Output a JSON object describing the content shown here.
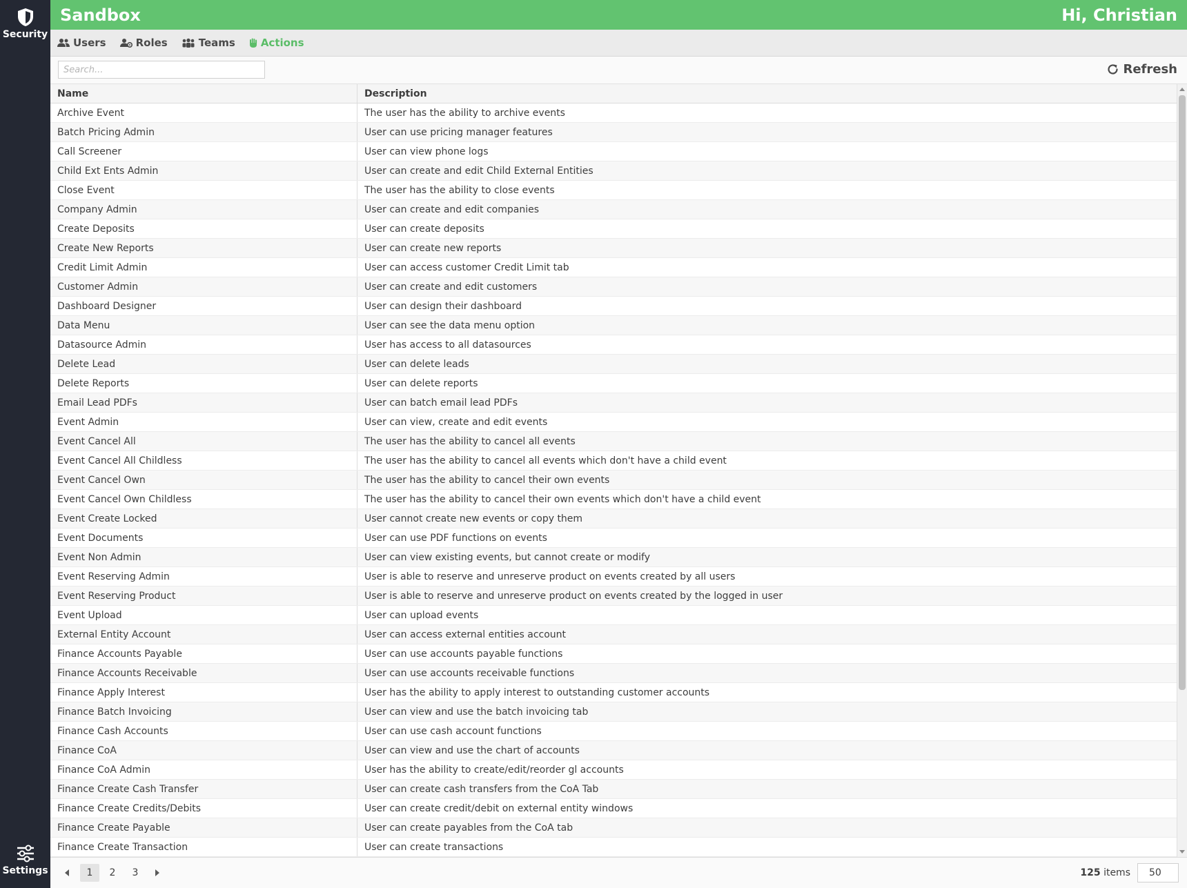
{
  "rail": {
    "top_label": "Security",
    "bottom_label": "Settings"
  },
  "header": {
    "title": "Sandbox",
    "greeting": "Hi, Christian"
  },
  "tabs": [
    {
      "label": "Users",
      "icon": "users-icon"
    },
    {
      "label": "Roles",
      "icon": "user-role-icon"
    },
    {
      "label": "Teams",
      "icon": "teams-icon"
    },
    {
      "label": "Actions",
      "icon": "hand-icon",
      "active": true
    }
  ],
  "toolbar": {
    "search_placeholder": "Search...",
    "refresh_label": "Refresh"
  },
  "grid": {
    "columns": [
      "Name",
      "Description"
    ],
    "rows": [
      [
        "Archive Event",
        "The user has the ability to archive events"
      ],
      [
        "Batch Pricing Admin",
        "User can use pricing manager features"
      ],
      [
        "Call Screener",
        "User can view phone logs"
      ],
      [
        "Child Ext Ents Admin",
        "User can create and edit Child External Entities"
      ],
      [
        "Close Event",
        "The user has the ability to close events"
      ],
      [
        "Company Admin",
        "User can create and edit companies"
      ],
      [
        "Create Deposits",
        "User can create deposits"
      ],
      [
        "Create New Reports",
        "User can create new reports"
      ],
      [
        "Credit Limit Admin",
        "User can access customer Credit Limit tab"
      ],
      [
        "Customer Admin",
        "User can create and edit customers"
      ],
      [
        "Dashboard Designer",
        "User can design their dashboard"
      ],
      [
        "Data Menu",
        "User can see the data menu option"
      ],
      [
        "Datasource Admin",
        "User has access to all datasources"
      ],
      [
        "Delete Lead",
        "User can delete leads"
      ],
      [
        "Delete Reports",
        "User can delete reports"
      ],
      [
        "Email Lead PDFs",
        "User can batch email lead PDFs"
      ],
      [
        "Event Admin",
        "User can view, create and edit events"
      ],
      [
        "Event Cancel All",
        "The user has the ability to cancel all events"
      ],
      [
        "Event Cancel All Childless",
        "The user has the ability to cancel all events which don't have a child event"
      ],
      [
        "Event Cancel Own",
        "The user has the ability to cancel their own events"
      ],
      [
        "Event Cancel Own Childless",
        "The user has the ability to cancel their own events which don't have a child event"
      ],
      [
        "Event Create Locked",
        "User cannot create new events or copy them"
      ],
      [
        "Event Documents",
        "User can use PDF functions on events"
      ],
      [
        "Event Non Admin",
        "User can view existing events, but cannot create or modify"
      ],
      [
        "Event Reserving Admin",
        "User is able to reserve and unreserve product on events created by all users"
      ],
      [
        "Event Reserving Product",
        "User is able to reserve and unreserve product on events created by the logged in user"
      ],
      [
        "Event Upload",
        "User can upload events"
      ],
      [
        "External Entity Account",
        "User can access external entities account"
      ],
      [
        "Finance Accounts Payable",
        "User can use accounts payable functions"
      ],
      [
        "Finance Accounts Receivable",
        "User can use accounts receivable functions"
      ],
      [
        "Finance Apply Interest",
        "User has the ability to apply interest to outstanding customer accounts"
      ],
      [
        "Finance Batch Invoicing",
        "User can view and use the batch invoicing tab"
      ],
      [
        "Finance Cash Accounts",
        "User can use cash account functions"
      ],
      [
        "Finance CoA",
        "User can view and use the chart of accounts"
      ],
      [
        "Finance CoA Admin",
        "User has the ability to create/edit/reorder gl accounts"
      ],
      [
        "Finance Create Cash Transfer",
        "User can create cash transfers from the CoA Tab"
      ],
      [
        "Finance Create Credits/Debits",
        "User can create credit/debit on external entity windows"
      ],
      [
        "Finance Create Payable",
        "User can create payables from the CoA tab"
      ],
      [
        "Finance Create Transaction",
        "User can create transactions"
      ]
    ]
  },
  "pager": {
    "pages": [
      "1",
      "2",
      "3"
    ],
    "active_page": "1",
    "total_count": "125",
    "items_label": "items",
    "page_size": "50"
  },
  "colors": {
    "header_green": "#62c370",
    "active_tab_green": "#5bbd68",
    "rail_dark": "#242833"
  }
}
